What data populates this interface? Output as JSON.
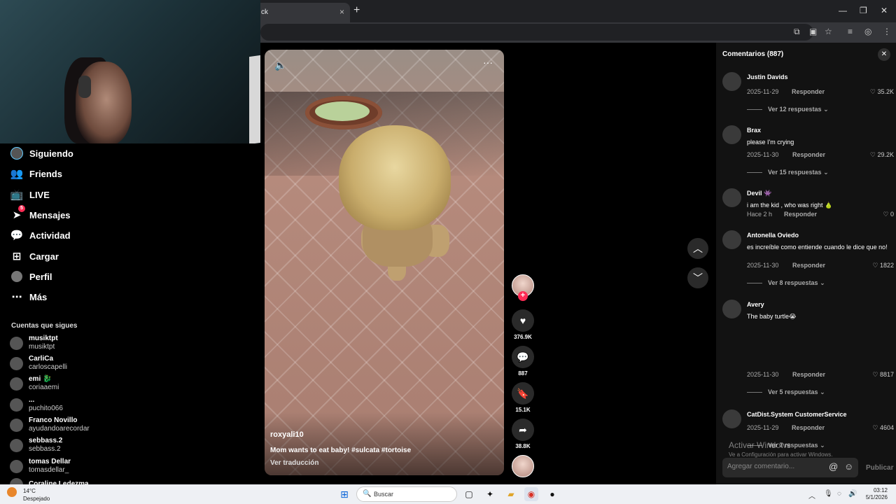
{
  "browser": {
    "tab_title": "ck",
    "tab_close": "×",
    "new_tab": "+"
  },
  "sidebar": {
    "nav": [
      {
        "label": "Siguiendo",
        "icon": "avatar-icon"
      },
      {
        "label": "Friends",
        "icon": "friends-icon"
      },
      {
        "label": "LIVE",
        "icon": "live-icon"
      },
      {
        "label": "Mensajes",
        "icon": "messages-icon",
        "badge": "5"
      },
      {
        "label": "Actividad",
        "icon": "activity-icon"
      },
      {
        "label": "Cargar",
        "icon": "upload-icon"
      },
      {
        "label": "Perfil",
        "icon": "profile-icon"
      },
      {
        "label": "Más",
        "icon": "more-icon"
      }
    ],
    "following_title": "Cuentas que sigues",
    "accounts": [
      {
        "name": "musiktpt",
        "handle": "musiktpt"
      },
      {
        "name": "CarliCa",
        "handle": "carloscapelli"
      },
      {
        "name": "emi 🐉",
        "handle": "coriaaemi"
      },
      {
        "name": "...",
        "handle": "puchito066"
      },
      {
        "name": "Franco Novillo",
        "handle": "ayudandoarecordar"
      },
      {
        "name": "sebbass.2",
        "handle": "sebbass.2"
      },
      {
        "name": "tomas Dellar",
        "handle": "tomasdellar_"
      },
      {
        "name": "Coraline Ledezma",
        "handle": ""
      }
    ]
  },
  "video": {
    "author": "roxyali10",
    "caption": "Mom wants to eat baby! #sulcata #tortoise",
    "translate": "Ver traducción",
    "sound_icon": "speaker-icon"
  },
  "actions": {
    "likes": "376.9K",
    "comments": "887",
    "saves": "15.1K",
    "shares": "38.8K"
  },
  "comments_panel": {
    "title": "Comentarios (887)",
    "items": [
      {
        "name": "Justin Davids",
        "text": "",
        "date": "2025-11-29",
        "likes": "35.2K",
        "replies": "Ver 12 respuestas"
      },
      {
        "name": "Brax",
        "text": "please I'm crying",
        "date": "2025-11-30",
        "likes": "29.2K",
        "replies": "Ver 15 respuestas"
      },
      {
        "name": "Devil 👾",
        "text": "i am the kid , who was right 🍐",
        "date": "Hace 2 h",
        "likes": "0",
        "replies": ""
      },
      {
        "name": "Antonella Oviedo",
        "text": "es increíble como entiende cuando le dice que no!",
        "date": "2025-11-30",
        "likes": "1822",
        "replies": "Ver 8 respuestas"
      },
      {
        "name": "Avery",
        "text": "The baby turtle😭",
        "date": "2025-11-30",
        "likes": "8817",
        "replies": "Ver 5 respuestas"
      },
      {
        "name": "CatDist.System CustomerService",
        "text": "",
        "date": "2025-11-29",
        "likes": "4604",
        "replies": "Ver 7 respuestas"
      }
    ],
    "reply_label": "Responder",
    "input_placeholder": "Agregar comentario...",
    "publish": "Publicar",
    "activate_title": "Activar Windows",
    "activate_sub": "Ve a Configuración para activar Windows."
  },
  "taskbar": {
    "temp": "14°C",
    "condition": "Despejado",
    "search": "Buscar",
    "time": "03:12",
    "date": "5/1/2026"
  }
}
